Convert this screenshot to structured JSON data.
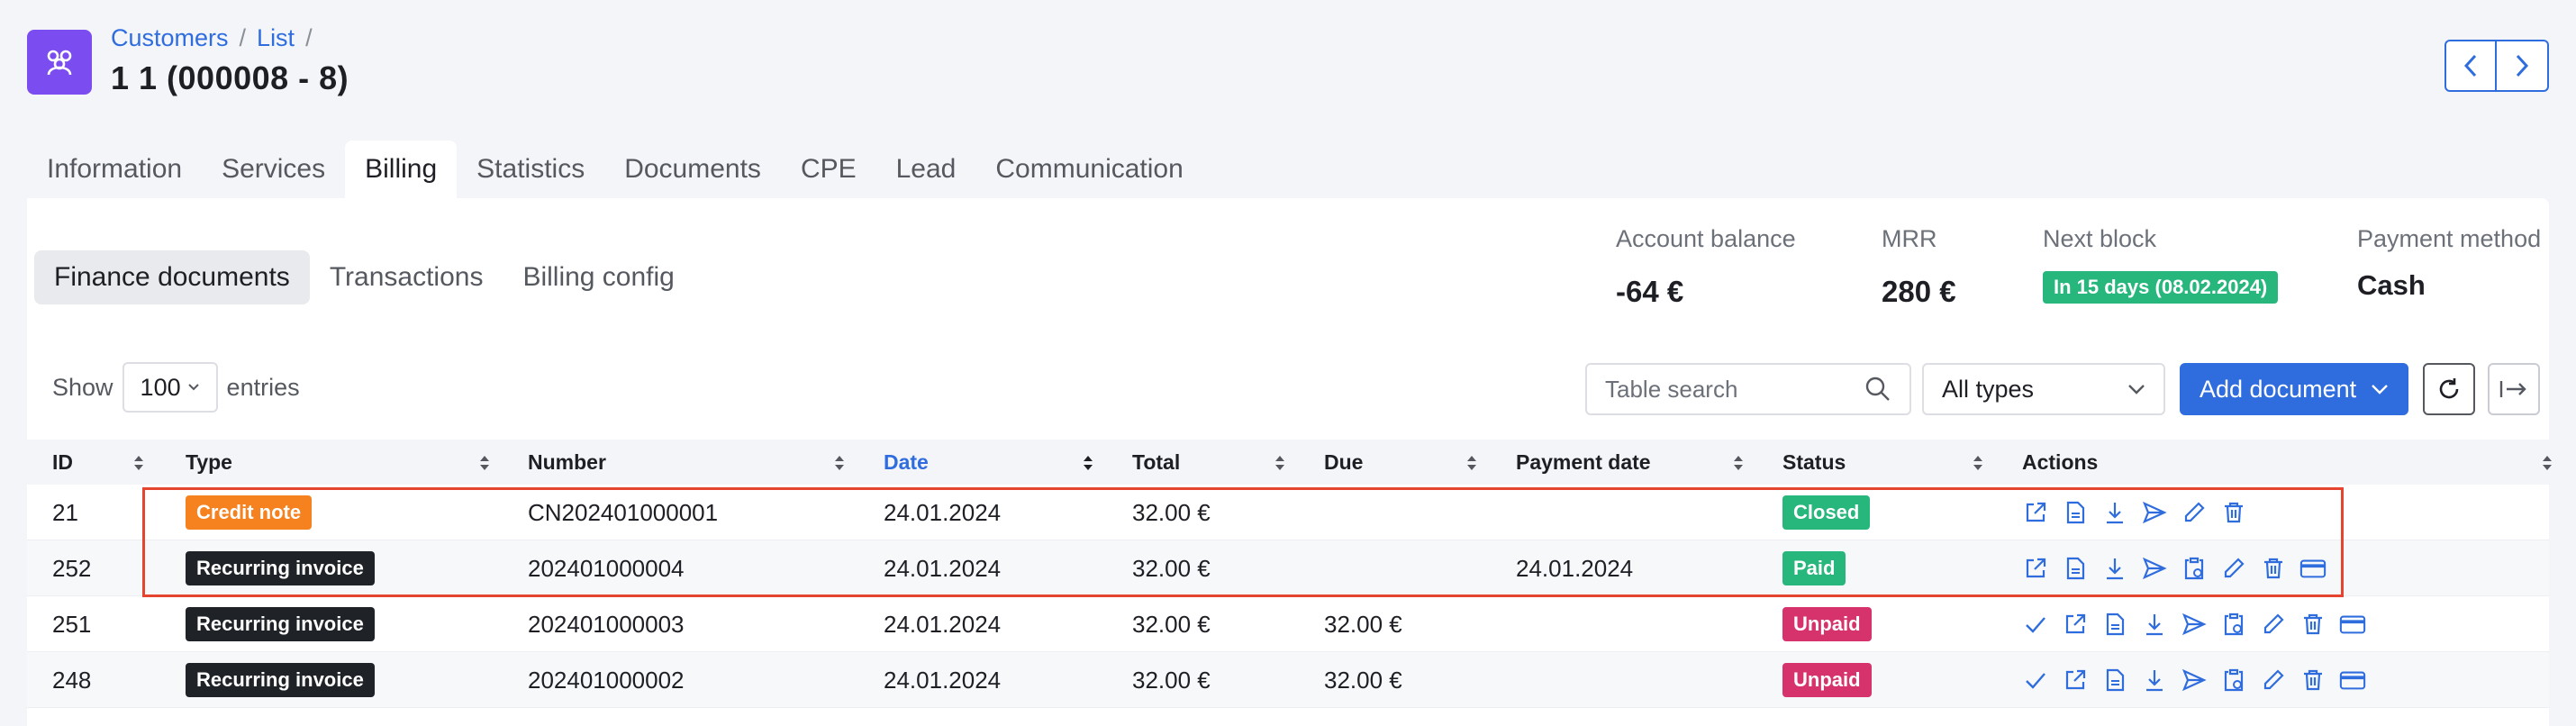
{
  "header": {
    "breadcrumb": [
      "Customers",
      "List"
    ],
    "title": "1 1 (000008 - 8)"
  },
  "main_tabs": [
    {
      "label": "Information",
      "active": false
    },
    {
      "label": "Services",
      "active": false
    },
    {
      "label": "Billing",
      "active": true
    },
    {
      "label": "Statistics",
      "active": false
    },
    {
      "label": "Documents",
      "active": false
    },
    {
      "label": "CPE",
      "active": false
    },
    {
      "label": "Lead",
      "active": false
    },
    {
      "label": "Communication",
      "active": false
    }
  ],
  "sub_tabs": [
    {
      "label": "Finance documents",
      "active": true
    },
    {
      "label": "Transactions",
      "active": false
    },
    {
      "label": "Billing config",
      "active": false
    }
  ],
  "summary": {
    "account_balance_label": "Account balance",
    "account_balance": "-64 €",
    "mrr_label": "MRR",
    "mrr": "280 €",
    "next_block_label": "Next block",
    "next_block": "In 15 days (08.02.2024)",
    "payment_method_label": "Payment method",
    "payment_method": "Cash"
  },
  "controls": {
    "show_label": "Show",
    "entries_value": "100",
    "entries_label": "entries",
    "search_placeholder": "Table search",
    "type_filter": "All types",
    "add_document_label": "Add document"
  },
  "table": {
    "columns": [
      "ID",
      "Type",
      "Number",
      "Date",
      "Total",
      "Due",
      "Payment date",
      "Status",
      "Actions"
    ],
    "rows": [
      {
        "id": "21",
        "type": "Credit note",
        "number": "CN202401000001",
        "date": "24.01.2024",
        "total": "32.00 €",
        "due": "",
        "payment_date": "",
        "status": "Closed"
      },
      {
        "id": "252",
        "type": "Recurring invoice",
        "number": "202401000004",
        "date": "24.01.2024",
        "total": "32.00 €",
        "due": "",
        "payment_date": "24.01.2024",
        "status": "Paid"
      },
      {
        "id": "251",
        "type": "Recurring invoice",
        "number": "202401000003",
        "date": "24.01.2024",
        "total": "32.00 €",
        "due": "32.00 €",
        "payment_date": "",
        "status": "Unpaid"
      },
      {
        "id": "248",
        "type": "Recurring invoice",
        "number": "202401000002",
        "date": "24.01.2024",
        "total": "32.00 €",
        "due": "32.00 €",
        "payment_date": "",
        "status": "Unpaid"
      }
    ]
  },
  "colors": {
    "accent": "#2f6ddf",
    "app_icon": "#7b4cf0",
    "credit_note": "#f5821f",
    "recurring_invoice": "#1f2327",
    "closed": "#27b67c",
    "paid": "#27b67c",
    "unpaid": "#d6336c",
    "highlight": "#e5452f"
  }
}
